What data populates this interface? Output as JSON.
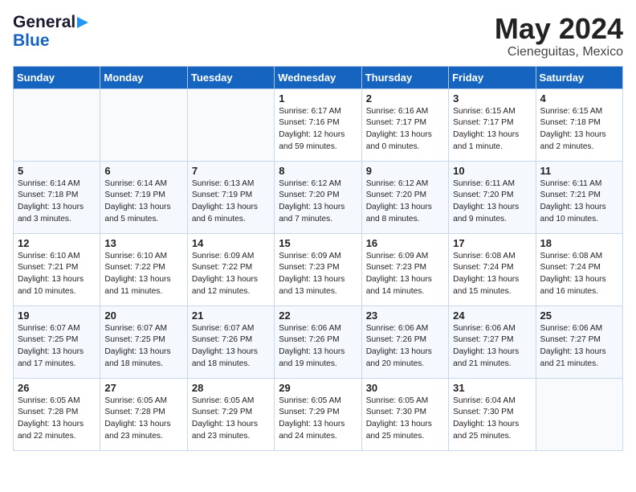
{
  "header": {
    "logo_general": "General",
    "logo_blue": "Blue",
    "month_year": "May 2024",
    "location": "Cieneguitas, Mexico"
  },
  "days_of_week": [
    "Sunday",
    "Monday",
    "Tuesday",
    "Wednesday",
    "Thursday",
    "Friday",
    "Saturday"
  ],
  "weeks": [
    [
      {
        "day": "",
        "info": ""
      },
      {
        "day": "",
        "info": ""
      },
      {
        "day": "",
        "info": ""
      },
      {
        "day": "1",
        "info": "Sunrise: 6:17 AM\nSunset: 7:16 PM\nDaylight: 12 hours\nand 59 minutes."
      },
      {
        "day": "2",
        "info": "Sunrise: 6:16 AM\nSunset: 7:17 PM\nDaylight: 13 hours\nand 0 minutes."
      },
      {
        "day": "3",
        "info": "Sunrise: 6:15 AM\nSunset: 7:17 PM\nDaylight: 13 hours\nand 1 minute."
      },
      {
        "day": "4",
        "info": "Sunrise: 6:15 AM\nSunset: 7:18 PM\nDaylight: 13 hours\nand 2 minutes."
      }
    ],
    [
      {
        "day": "5",
        "info": "Sunrise: 6:14 AM\nSunset: 7:18 PM\nDaylight: 13 hours\nand 3 minutes."
      },
      {
        "day": "6",
        "info": "Sunrise: 6:14 AM\nSunset: 7:19 PM\nDaylight: 13 hours\nand 5 minutes."
      },
      {
        "day": "7",
        "info": "Sunrise: 6:13 AM\nSunset: 7:19 PM\nDaylight: 13 hours\nand 6 minutes."
      },
      {
        "day": "8",
        "info": "Sunrise: 6:12 AM\nSunset: 7:20 PM\nDaylight: 13 hours\nand 7 minutes."
      },
      {
        "day": "9",
        "info": "Sunrise: 6:12 AM\nSunset: 7:20 PM\nDaylight: 13 hours\nand 8 minutes."
      },
      {
        "day": "10",
        "info": "Sunrise: 6:11 AM\nSunset: 7:20 PM\nDaylight: 13 hours\nand 9 minutes."
      },
      {
        "day": "11",
        "info": "Sunrise: 6:11 AM\nSunset: 7:21 PM\nDaylight: 13 hours\nand 10 minutes."
      }
    ],
    [
      {
        "day": "12",
        "info": "Sunrise: 6:10 AM\nSunset: 7:21 PM\nDaylight: 13 hours\nand 10 minutes."
      },
      {
        "day": "13",
        "info": "Sunrise: 6:10 AM\nSunset: 7:22 PM\nDaylight: 13 hours\nand 11 minutes."
      },
      {
        "day": "14",
        "info": "Sunrise: 6:09 AM\nSunset: 7:22 PM\nDaylight: 13 hours\nand 12 minutes."
      },
      {
        "day": "15",
        "info": "Sunrise: 6:09 AM\nSunset: 7:23 PM\nDaylight: 13 hours\nand 13 minutes."
      },
      {
        "day": "16",
        "info": "Sunrise: 6:09 AM\nSunset: 7:23 PM\nDaylight: 13 hours\nand 14 minutes."
      },
      {
        "day": "17",
        "info": "Sunrise: 6:08 AM\nSunset: 7:24 PM\nDaylight: 13 hours\nand 15 minutes."
      },
      {
        "day": "18",
        "info": "Sunrise: 6:08 AM\nSunset: 7:24 PM\nDaylight: 13 hours\nand 16 minutes."
      }
    ],
    [
      {
        "day": "19",
        "info": "Sunrise: 6:07 AM\nSunset: 7:25 PM\nDaylight: 13 hours\nand 17 minutes."
      },
      {
        "day": "20",
        "info": "Sunrise: 6:07 AM\nSunset: 7:25 PM\nDaylight: 13 hours\nand 18 minutes."
      },
      {
        "day": "21",
        "info": "Sunrise: 6:07 AM\nSunset: 7:26 PM\nDaylight: 13 hours\nand 18 minutes."
      },
      {
        "day": "22",
        "info": "Sunrise: 6:06 AM\nSunset: 7:26 PM\nDaylight: 13 hours\nand 19 minutes."
      },
      {
        "day": "23",
        "info": "Sunrise: 6:06 AM\nSunset: 7:26 PM\nDaylight: 13 hours\nand 20 minutes."
      },
      {
        "day": "24",
        "info": "Sunrise: 6:06 AM\nSunset: 7:27 PM\nDaylight: 13 hours\nand 21 minutes."
      },
      {
        "day": "25",
        "info": "Sunrise: 6:06 AM\nSunset: 7:27 PM\nDaylight: 13 hours\nand 21 minutes."
      }
    ],
    [
      {
        "day": "26",
        "info": "Sunrise: 6:05 AM\nSunset: 7:28 PM\nDaylight: 13 hours\nand 22 minutes."
      },
      {
        "day": "27",
        "info": "Sunrise: 6:05 AM\nSunset: 7:28 PM\nDaylight: 13 hours\nand 23 minutes."
      },
      {
        "day": "28",
        "info": "Sunrise: 6:05 AM\nSunset: 7:29 PM\nDaylight: 13 hours\nand 23 minutes."
      },
      {
        "day": "29",
        "info": "Sunrise: 6:05 AM\nSunset: 7:29 PM\nDaylight: 13 hours\nand 24 minutes."
      },
      {
        "day": "30",
        "info": "Sunrise: 6:05 AM\nSunset: 7:30 PM\nDaylight: 13 hours\nand 25 minutes."
      },
      {
        "day": "31",
        "info": "Sunrise: 6:04 AM\nSunset: 7:30 PM\nDaylight: 13 hours\nand 25 minutes."
      },
      {
        "day": "",
        "info": ""
      }
    ]
  ]
}
